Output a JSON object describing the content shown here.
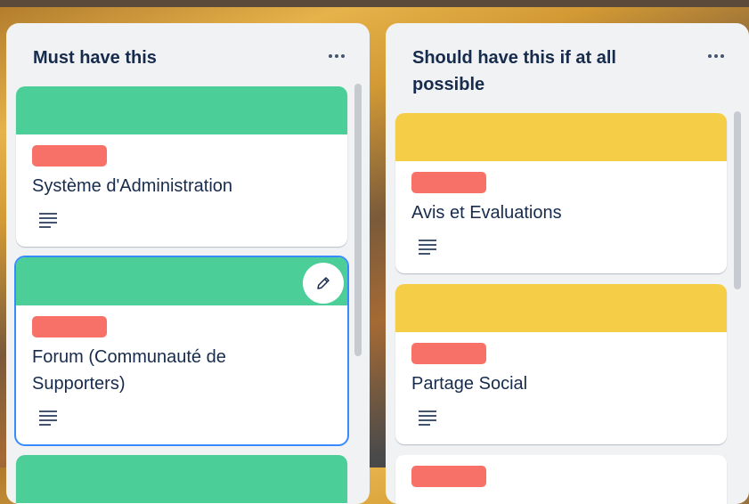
{
  "colors": {
    "list_bg": "#f1f2f4",
    "green_cover": "#4bce97",
    "yellow_cover": "#f5cd47",
    "label_red": "#f87168",
    "text": "#172b4d",
    "focus": "#388bff"
  },
  "lists": [
    {
      "title": "Must have this",
      "menu_icon": "more-horizontal-icon",
      "cards": [
        {
          "title": "Système d'Administration",
          "cover": "green",
          "label": "red",
          "has_description": true
        },
        {
          "title": "Forum (Communauté de Supporters)",
          "cover": "green",
          "label": "red",
          "has_description": true,
          "hovered": true,
          "edit_icon": "pencil-icon"
        },
        {
          "cover": "green"
        }
      ]
    },
    {
      "title": "Should have this if at all possible",
      "menu_icon": "more-horizontal-icon",
      "cards": [
        {
          "title": "Avis et Evaluations",
          "cover": "yellow",
          "label": "red",
          "has_description": true
        },
        {
          "title": "Partage Social",
          "cover": "yellow",
          "label": "red",
          "has_description": true
        },
        {
          "label": "red"
        }
      ]
    }
  ]
}
